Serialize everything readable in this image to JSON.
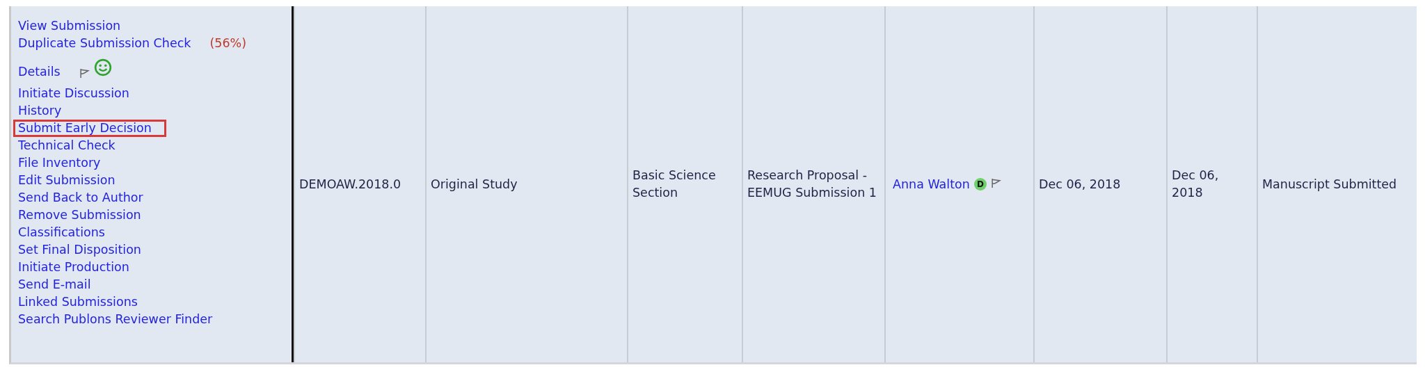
{
  "actions": [
    {
      "kind": "link",
      "label": "View Submission",
      "highlighted": false
    },
    {
      "kind": "check",
      "label": "Duplicate Submission Check",
      "score": "(56%)",
      "highlighted": false
    },
    {
      "kind": "details",
      "label": "Details",
      "highlighted": false
    },
    {
      "kind": "link",
      "label": "Initiate Discussion",
      "highlighted": false
    },
    {
      "kind": "link",
      "label": "History",
      "highlighted": false
    },
    {
      "kind": "link",
      "label": "Submit Early Decision",
      "highlighted": true
    },
    {
      "kind": "link",
      "label": "Technical Check",
      "highlighted": false
    },
    {
      "kind": "link",
      "label": "File Inventory",
      "highlighted": false
    },
    {
      "kind": "link",
      "label": "Edit Submission",
      "highlighted": false
    },
    {
      "kind": "link",
      "label": "Send Back to Author",
      "highlighted": false
    },
    {
      "kind": "link",
      "label": "Remove Submission",
      "highlighted": false
    },
    {
      "kind": "link",
      "label": "Classifications",
      "highlighted": false
    },
    {
      "kind": "link",
      "label": "Set Final Disposition",
      "highlighted": false
    },
    {
      "kind": "link",
      "label": "Initiate Production",
      "highlighted": false
    },
    {
      "kind": "link",
      "label": "Send E-mail",
      "highlighted": false
    },
    {
      "kind": "link",
      "label": "Linked Submissions",
      "highlighted": false
    },
    {
      "kind": "link",
      "label": "Search Publons Reviewer Finder",
      "highlighted": false
    }
  ],
  "cells": [
    {
      "kind": "text",
      "text": "DEMOAW.2018.0"
    },
    {
      "kind": "text",
      "text": "Original Study"
    },
    {
      "kind": "text",
      "text": "Basic Science Section"
    },
    {
      "kind": "text",
      "text": "Research Proposal - EEMUG Submission 1"
    },
    {
      "kind": "author",
      "text": "Anna Walton",
      "badge": "D"
    },
    {
      "kind": "text",
      "text": "Dec 06, 2018"
    },
    {
      "kind": "text",
      "text": "Dec 06, 2018"
    },
    {
      "kind": "text",
      "text": "Manuscript Submitted"
    }
  ]
}
